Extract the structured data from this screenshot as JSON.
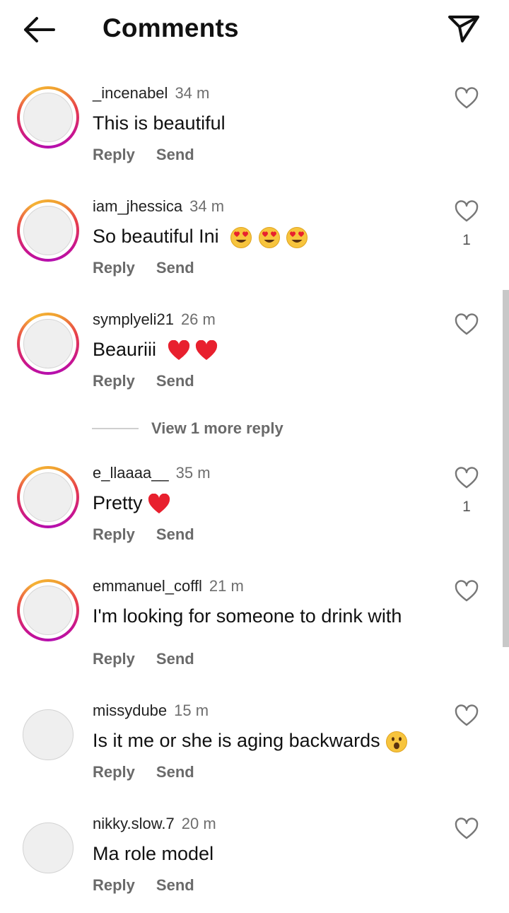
{
  "header": {
    "back_icon": "arrow-left-icon",
    "title": "Comments",
    "share_icon": "paper-plane-icon"
  },
  "actions": {
    "reply": "Reply",
    "send": "Send"
  },
  "comments": [
    {
      "username": "_incenabel",
      "time": "34 m",
      "text": "This is beautiful",
      "likes": "",
      "story_ring": true
    },
    {
      "username": "iam_jhessica",
      "time": "34 m",
      "text": "So beautiful Ini",
      "emojis": [
        "heart-eyes",
        "heart-eyes",
        "heart-eyes"
      ],
      "likes": "1",
      "story_ring": true
    },
    {
      "username": "symplyeli21",
      "time": "26 m",
      "text": "Beauriii",
      "emojis": [
        "red-heart",
        "red-heart"
      ],
      "likes": "",
      "story_ring": true
    },
    {
      "username": "e_llaaaa__",
      "time": "35 m",
      "text": "Pretty",
      "emojis": [
        "red-heart"
      ],
      "likes": "1",
      "story_ring": true
    },
    {
      "username": "emmanuel_coffl",
      "time": "21 m",
      "text": "I'm looking for someone to drink with",
      "likes": "",
      "story_ring": true
    },
    {
      "username": "missydube",
      "time": "15 m",
      "text": "Is it me or she is aging backwards",
      "emojis": [
        "astonished-face"
      ],
      "likes": "",
      "story_ring": false
    },
    {
      "username": "nikky.slow.7",
      "time": "20 m",
      "text": "Ma role model",
      "likes": "",
      "story_ring": false
    }
  ],
  "view_more_reply": "View 1 more reply",
  "colors": {
    "ring_gradient": [
      "#f5b336",
      "#e8404a",
      "#c81490"
    ],
    "muted_text": "#6a6a6a",
    "heart_emoji": "#e8202e"
  }
}
